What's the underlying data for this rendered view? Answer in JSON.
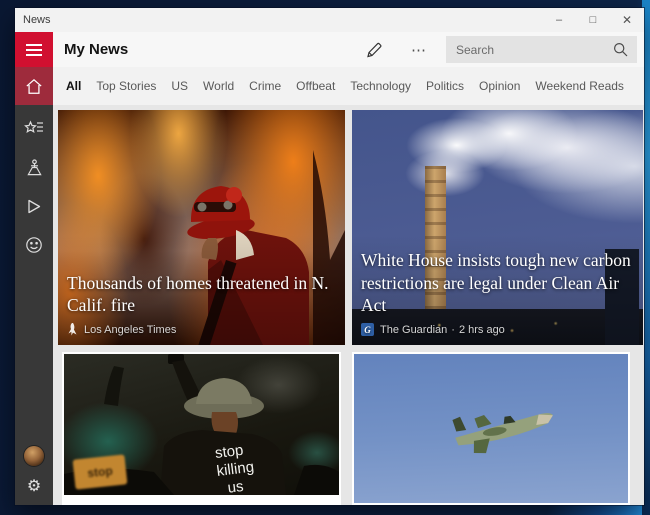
{
  "window": {
    "title": "News",
    "controls": {
      "minimize": "–",
      "maximize": "□",
      "close": "✕"
    }
  },
  "header": {
    "title": "My News",
    "more_icon": "⋯",
    "search_placeholder": "Search"
  },
  "tabs": {
    "active": "All",
    "items": [
      {
        "label": "All"
      },
      {
        "label": "Top Stories"
      },
      {
        "label": "US"
      },
      {
        "label": "World"
      },
      {
        "label": "Crime"
      },
      {
        "label": "Offbeat"
      },
      {
        "label": "Technology"
      },
      {
        "label": "Politics"
      },
      {
        "label": "Opinion"
      },
      {
        "label": "Weekend Reads"
      }
    ]
  },
  "articles": {
    "wildfire": {
      "headline": "Thousands of homes threatened in N. Calif. fire",
      "source": "Los Angeles Times",
      "image": "firefighter-wildfire-photo"
    },
    "carbon": {
      "headline": "White House insists tough new carbon restrictions are legal under Clean Air Act",
      "source": "The Guardian",
      "separator": "·",
      "time": "2 hrs ago",
      "image": "smokestack-pollution-photo"
    },
    "protest": {
      "image": "night-protest-photo",
      "shirt_line1": "stop",
      "shirt_line2": "killing",
      "shirt_line3": "us",
      "sign_text": "stop"
    },
    "jet": {
      "image": "military-jet-sky-photo"
    }
  },
  "colors": {
    "accent_red": "#d11030",
    "home_selected_red": "#9e2b3c",
    "sidebar_gray": "#383838",
    "content_gray": "#e6e6e6",
    "desktop_navy": "#0d2144",
    "desktop_blue": "#1e7ed2"
  }
}
